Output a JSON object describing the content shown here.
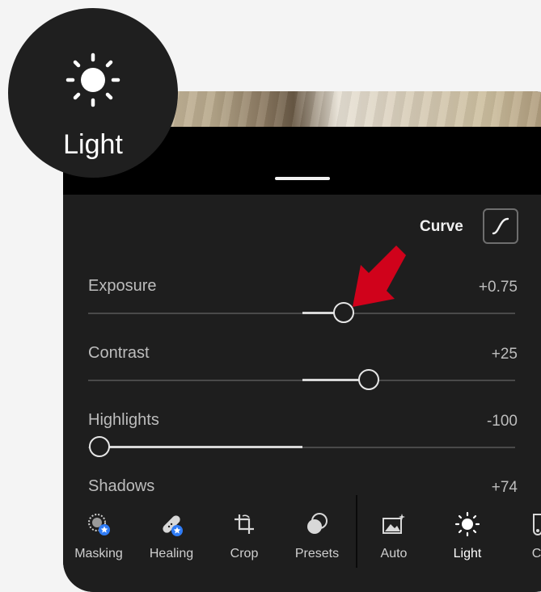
{
  "header": {
    "curve_label": "Curve",
    "curve_icon": "tone-curve-icon"
  },
  "sliders": [
    {
      "label": "Exposure",
      "value": "+0.75"
    },
    {
      "label": "Contrast",
      "value": "+25"
    },
    {
      "label": "Highlights",
      "value": "-100"
    },
    {
      "label": "Shadows",
      "value": "+74"
    }
  ],
  "toolbar": {
    "items": [
      {
        "label": "Masking",
        "icon": "masking-icon"
      },
      {
        "label": "Healing",
        "icon": "healing-bandage-icon"
      },
      {
        "label": "Crop",
        "icon": "crop-icon"
      },
      {
        "label": "Presets",
        "icon": "presets-icon"
      },
      {
        "label": "Auto",
        "icon": "auto-image-icon"
      },
      {
        "label": "Light",
        "icon": "sun-icon",
        "active": true
      },
      {
        "label": "Co",
        "icon": "color-icon"
      }
    ]
  },
  "callout": {
    "label": "Light",
    "icon": "sun-icon"
  },
  "annotation": {
    "icon": "red-arrow-icon",
    "color": "#d0021b"
  }
}
